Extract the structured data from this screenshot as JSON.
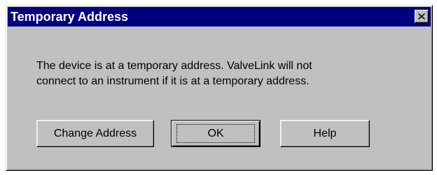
{
  "window": {
    "title": "Temporary Address"
  },
  "message": {
    "line1": "The device is at a temporary address.  ValveLink will not",
    "line2": "connect to an instrument if it is at a temporary address."
  },
  "buttons": {
    "change_address": "Change Address",
    "ok": "OK",
    "help": "Help"
  },
  "icons": {
    "close": "close-icon"
  },
  "colors": {
    "titlebar": "#000080",
    "face": "#c0c0c0"
  }
}
